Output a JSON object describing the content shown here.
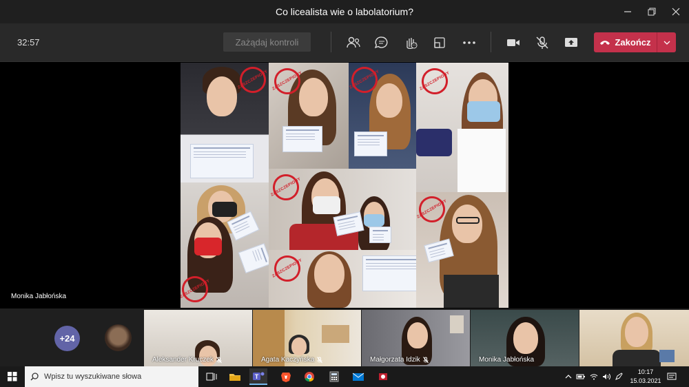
{
  "window": {
    "title": "Co licealista wie o labolatorium?"
  },
  "toolbar": {
    "timer": "32:57",
    "request_control_label": "Zażądaj kontroli",
    "hangup_label": "Zakończ"
  },
  "stage": {
    "presenter_name": "Monika Jabłońska",
    "stamp_text": "ZASZCZEPIONY"
  },
  "participants": {
    "overflow_count": "+24",
    "tiles": [
      {
        "name": "Aleksander Kruczek",
        "muted": true
      },
      {
        "name": "Agata Kaczyńska",
        "muted": true
      },
      {
        "name": "Małgorzata Idzik",
        "muted": true
      },
      {
        "name": "Monika Jabłońska",
        "muted": false
      },
      {
        "name": "",
        "muted": false
      }
    ]
  },
  "taskbar": {
    "search_placeholder": "Wpisz tu wyszukiwane słowa",
    "time": "10:17",
    "date": "15.03.2021"
  },
  "colors": {
    "hangup": "#c4314b",
    "more_badge": "#6264a7",
    "stamp": "#d21f2a"
  }
}
